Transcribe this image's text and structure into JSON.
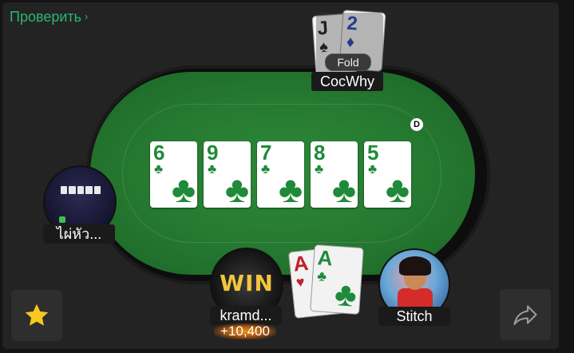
{
  "header": {
    "check_link_label": "Проверить",
    "check_link_chevron": "›"
  },
  "board": {
    "cards": [
      {
        "rank": "6",
        "suit": "♣"
      },
      {
        "rank": "9",
        "suit": "♣"
      },
      {
        "rank": "7",
        "suit": "♣"
      },
      {
        "rank": "8",
        "suit": "♣"
      },
      {
        "rank": "5",
        "suit": "♣"
      }
    ]
  },
  "dealer_button": "D",
  "players": {
    "top": {
      "name": "CocWhy",
      "status": "Fold",
      "cards": [
        {
          "rank": "J",
          "suit": "♠"
        },
        {
          "rank": "2",
          "suit": "♦"
        }
      ]
    },
    "left": {
      "name": "ไผ่หัว..."
    },
    "hero": {
      "name": "kramd...",
      "avatar_text": "WIN",
      "win_amount": "+10,400",
      "cards": [
        {
          "rank": "A",
          "suit": "♥"
        },
        {
          "rank": "A",
          "suit": "♣"
        }
      ]
    },
    "right": {
      "name": "Stitch"
    }
  },
  "buttons": {
    "favorite_icon": "star-icon",
    "share_icon": "share-icon"
  },
  "colors": {
    "felt": "#2e8a3a",
    "link": "#2bb673",
    "star": "#f7c81e"
  }
}
